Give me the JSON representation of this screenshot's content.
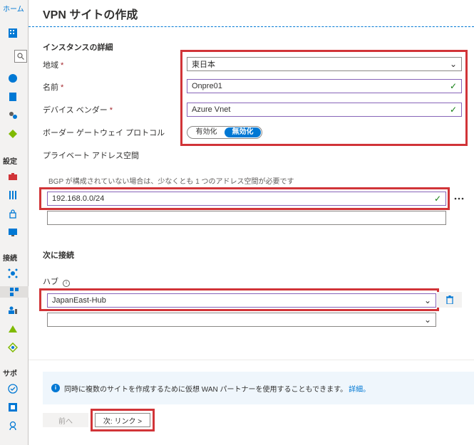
{
  "breadcrumb": {
    "home": "ホーム"
  },
  "sidebar": {
    "section_settings": "設定",
    "section_connectivity": "接続",
    "section_support": "サポ"
  },
  "panel": {
    "title": "VPN サイトの作成",
    "instance_details_title": "インスタンスの詳細",
    "region": {
      "label": "地域",
      "value": "東日本"
    },
    "name": {
      "label": "名前",
      "value": "Onpre01"
    },
    "device_vendor": {
      "label": "デバイス ベンダー",
      "value": "Azure Vnet"
    },
    "bgp": {
      "label": "ボーダー ゲートウェイ プロトコル",
      "enabled_label": "有効化",
      "disabled_label": "無効化",
      "selected": "無効化"
    },
    "private_address": {
      "label": "プライベート アドレス空間",
      "hint": "BGP が構成されていない場合は、少なくとも 1 つのアドレス空間が必要です",
      "value": "192.168.0.0/24",
      "empty_value": ""
    },
    "connect_to": {
      "title": "次に接続",
      "hub_label": "ハブ",
      "hub_value": "JapanEast-Hub",
      "hub_empty_value": ""
    },
    "info": {
      "text": "同時に複数のサイトを作成するために仮想 WAN パートナーを使用することもできます。",
      "link": "詳細。"
    },
    "footer": {
      "prev_label": "前へ",
      "next_label": "次: リンク >"
    }
  },
  "colors": {
    "accent": "#0078d4",
    "highlight": "#d13438",
    "valid": "#107c10"
  }
}
